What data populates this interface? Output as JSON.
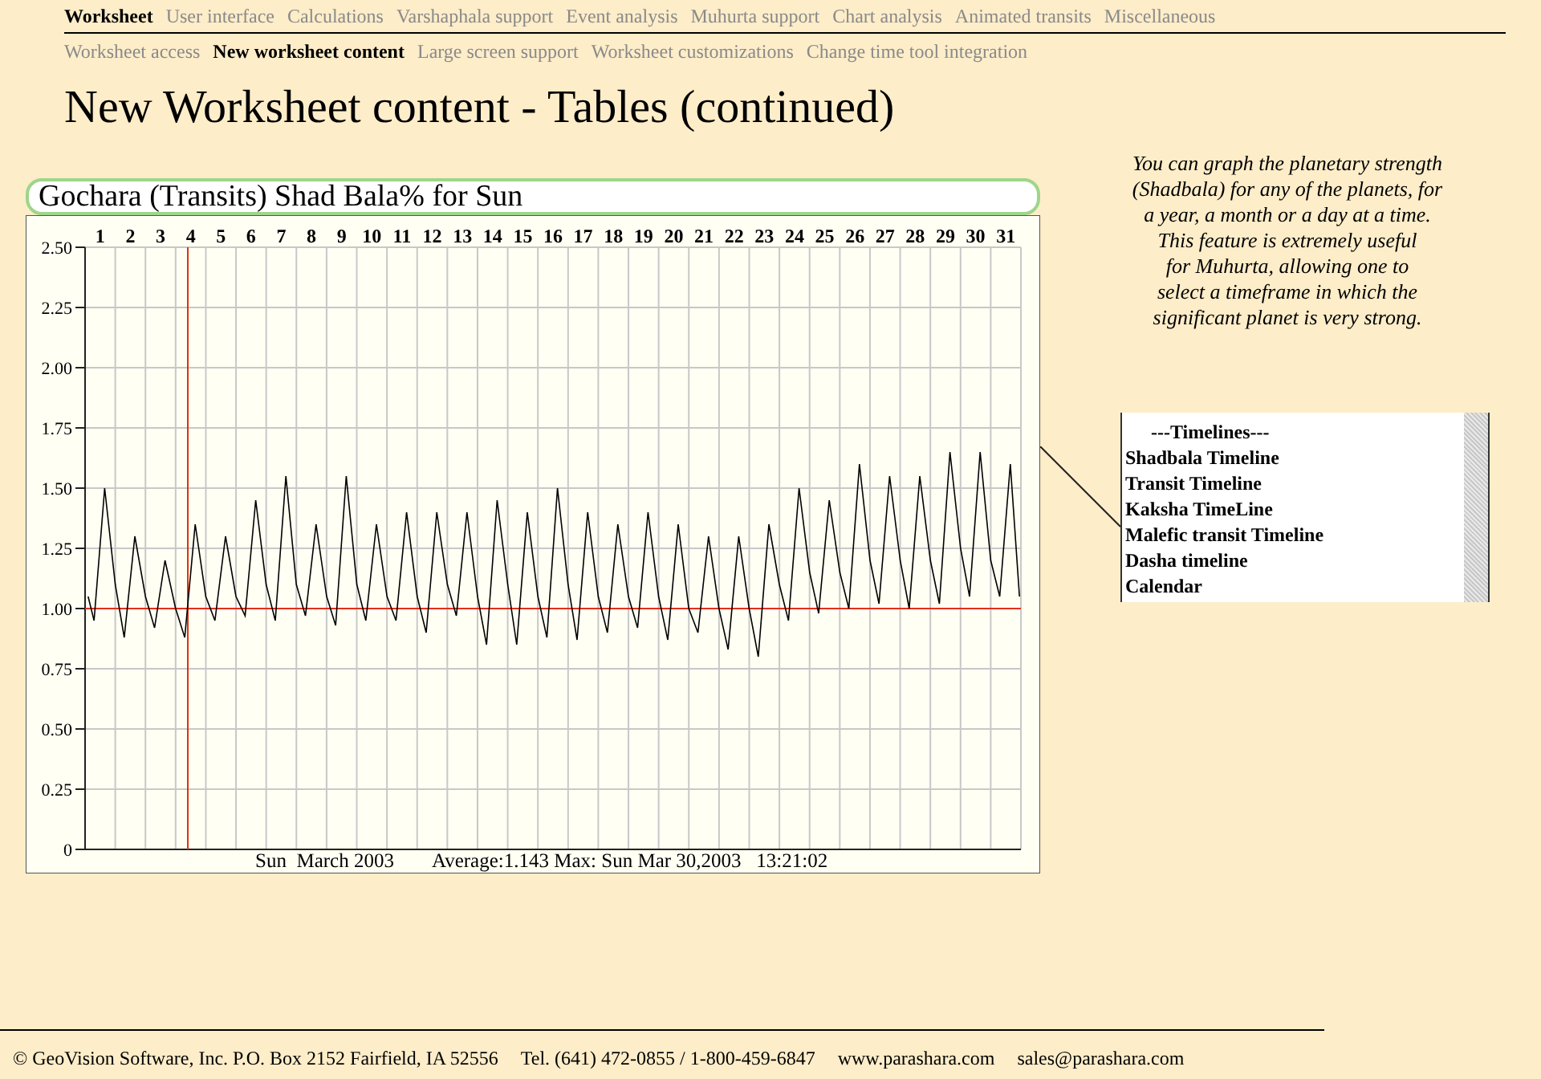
{
  "nav": {
    "primary": [
      {
        "label": "Worksheet",
        "selected": true
      },
      {
        "label": "User interface",
        "selected": false
      },
      {
        "label": "Calculations",
        "selected": false
      },
      {
        "label": "Varshaphala support",
        "selected": false
      },
      {
        "label": "Event analysis",
        "selected": false
      },
      {
        "label": "Muhurta support",
        "selected": false
      },
      {
        "label": "Chart analysis",
        "selected": false
      },
      {
        "label": "Animated transits",
        "selected": false
      },
      {
        "label": "Miscellaneous",
        "selected": false
      }
    ],
    "secondary": [
      {
        "label": "Worksheet access",
        "selected": false
      },
      {
        "label": "New worksheet content",
        "selected": true
      },
      {
        "label": "Large screen support",
        "selected": false
      },
      {
        "label": "Worksheet customizations",
        "selected": false
      },
      {
        "label": "Change time tool integration",
        "selected": false
      }
    ]
  },
  "heading": "New Worksheet content - Tables (continued)",
  "chart_panel": {
    "chart_data": {
      "type": "line",
      "grid": true,
      "title": "Gochara (Transits) Shad Bala% for Sun",
      "xlim": [
        0.5,
        31.5
      ],
      "ylim": [
        0,
        2.5
      ],
      "xticks": [
        1,
        2,
        3,
        4,
        5,
        6,
        7,
        8,
        9,
        10,
        11,
        12,
        13,
        14,
        15,
        16,
        17,
        18,
        19,
        20,
        21,
        22,
        23,
        24,
        25,
        26,
        27,
        28,
        29,
        30,
        31
      ],
      "yticks": [
        {
          "value": 2.5,
          "label": "2.50"
        },
        {
          "value": 2.25,
          "label": "2.25"
        },
        {
          "value": 2,
          "label": "2.00"
        },
        {
          "value": 1.75,
          "label": "1.75"
        },
        {
          "value": 1.5,
          "label": "1.50"
        },
        {
          "value": 1.25,
          "label": "1.25"
        },
        {
          "value": 1,
          "label": "1.00"
        },
        {
          "value": 0.75,
          "label": "0.75"
        },
        {
          "value": 0.5,
          "label": "0.50"
        },
        {
          "value": 0.25,
          "label": "0.25"
        },
        {
          "value": 0,
          "label": "0"
        }
      ],
      "x": [
        0.6,
        0.8,
        1.15,
        1.5,
        1.8,
        2.15,
        2.5,
        2.8,
        3.15,
        3.5,
        3.8,
        4.15,
        4.5,
        4.8,
        5.15,
        5.5,
        5.8,
        6.15,
        6.5,
        6.8,
        7.15,
        7.5,
        7.8,
        8.15,
        8.5,
        8.8,
        9.15,
        9.5,
        9.8,
        10.15,
        10.5,
        10.8,
        11.15,
        11.5,
        11.8,
        12.15,
        12.5,
        12.8,
        13.15,
        13.5,
        13.8,
        14.15,
        14.5,
        14.8,
        15.15,
        15.5,
        15.8,
        16.15,
        16.5,
        16.8,
        17.15,
        17.5,
        17.8,
        18.15,
        18.5,
        18.8,
        19.15,
        19.5,
        19.8,
        20.15,
        20.5,
        20.8,
        21.15,
        21.5,
        21.8,
        22.15,
        22.5,
        22.8,
        23.15,
        23.5,
        23.8,
        24.15,
        24.5,
        24.8,
        25.15,
        25.5,
        25.8,
        26.15,
        26.5,
        26.8,
        27.15,
        27.5,
        27.8,
        28.15,
        28.5,
        28.8,
        29.15,
        29.5,
        29.8,
        30.15,
        30.5,
        30.8,
        31.15,
        31.45
      ],
      "series": [
        {
          "color": "#000000",
          "values": [
            1.05,
            0.95,
            1.5,
            1.1,
            0.88,
            1.3,
            1.05,
            0.92,
            1.2,
            1.0,
            0.88,
            1.35,
            1.05,
            0.95,
            1.3,
            1.05,
            0.97,
            1.45,
            1.1,
            0.95,
            1.55,
            1.1,
            0.97,
            1.35,
            1.05,
            0.93,
            1.55,
            1.1,
            0.95,
            1.35,
            1.05,
            0.95,
            1.4,
            1.05,
            0.9,
            1.4,
            1.1,
            0.97,
            1.4,
            1.05,
            0.85,
            1.45,
            1.1,
            0.85,
            1.4,
            1.05,
            0.88,
            1.5,
            1.1,
            0.87,
            1.4,
            1.05,
            0.9,
            1.35,
            1.05,
            0.92,
            1.4,
            1.05,
            0.87,
            1.35,
            1.0,
            0.9,
            1.3,
            1.0,
            0.83,
            1.3,
            1.0,
            0.8,
            1.35,
            1.1,
            0.95,
            1.5,
            1.15,
            0.98,
            1.45,
            1.15,
            1.0,
            1.6,
            1.2,
            1.02,
            1.55,
            1.2,
            1.0,
            1.55,
            1.2,
            1.02,
            1.65,
            1.25,
            1.05,
            1.65,
            1.2,
            1.05,
            1.6,
            1.05
          ]
        }
      ]
    },
    "caption_period": "Sun  March 2003",
    "caption_stats": "Average:1.143 Max: Sun Mar 30,2003   13:21:02"
  },
  "description": "You can graph the planetary strength\n(Shadbala) for any of the planets, for\na year, a month or a day at a time.\nThis feature is extremely useful\nfor Muhurta, allowing one to\nselect a timeframe in which the\nsignificant planet is very strong.",
  "timelines_list": {
    "header": "---Timelines---",
    "items": [
      "Shadbala Timeline",
      "Transit Timeline",
      "Kaksha TimeLine",
      "Malefic transit Timeline",
      "Dasha timeline",
      "Calendar"
    ]
  },
  "footer": {
    "address": "© GeoVision Software, Inc. P.O. Box 2152 Fairfield, IA 52556",
    "phone": "Tel. (641) 472-0855 / 1-800-459-6847",
    "website": "www.parashara.com",
    "email": "sales@parashara.com"
  }
}
